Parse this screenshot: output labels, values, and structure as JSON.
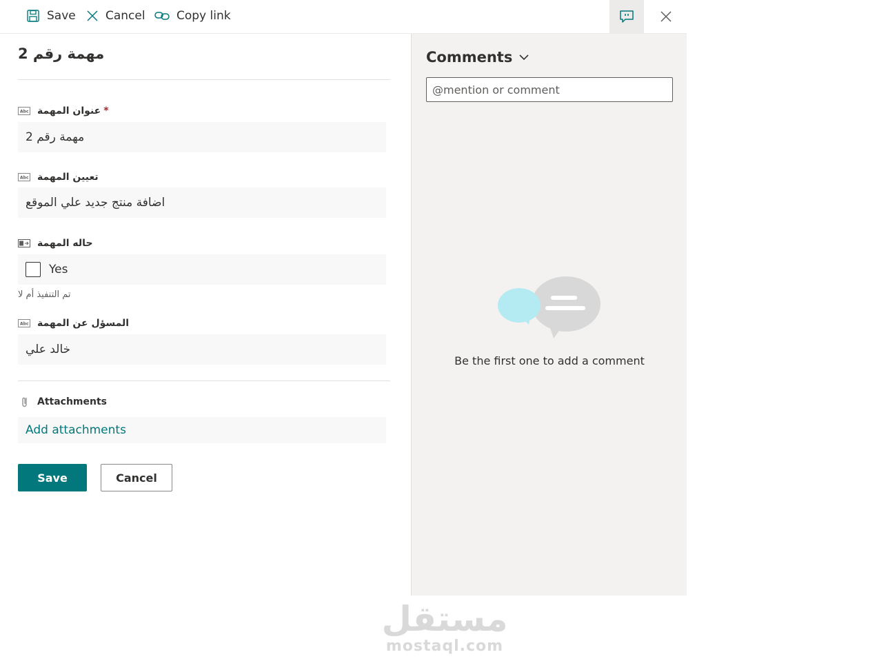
{
  "toolbar": {
    "save_label": "Save",
    "cancel_label": "Cancel",
    "copy_link_label": "Copy link"
  },
  "form": {
    "title": "مهمة رقم 2",
    "fields": [
      {
        "label": "عنوان المهمة",
        "required": "*",
        "value": "مهمة رقم 2",
        "icon": "text-field-icon"
      },
      {
        "label": "تعيين المهمة",
        "value": "اضافة منتج جديد علي الموقع",
        "icon": "text-field-icon"
      },
      {
        "label": "حاله المهمة",
        "value": "Yes",
        "checked": false,
        "hint": "تم التنفيذ أم لا",
        "icon": "yes-no-field-icon"
      },
      {
        "label": "المسؤل عن المهمة",
        "value": "خالد علي",
        "icon": "text-field-icon"
      }
    ],
    "attachments": {
      "label": "Attachments",
      "add_label": "Add attachments"
    },
    "save_label": "Save",
    "cancel_label": "Cancel"
  },
  "comments": {
    "header": "Comments",
    "placeholder": "@mention or comment",
    "empty_text": "Be the first one to add a comment"
  },
  "watermark": {
    "arabic": "مستقل",
    "latin": "mostaql.com"
  },
  "colors": {
    "accent": "#03787c",
    "required": "#a4262c",
    "pane_background": "#f3f2f1",
    "bubble_blue": "#b4eaf2",
    "bubble_gray": "#d8d8d8"
  }
}
